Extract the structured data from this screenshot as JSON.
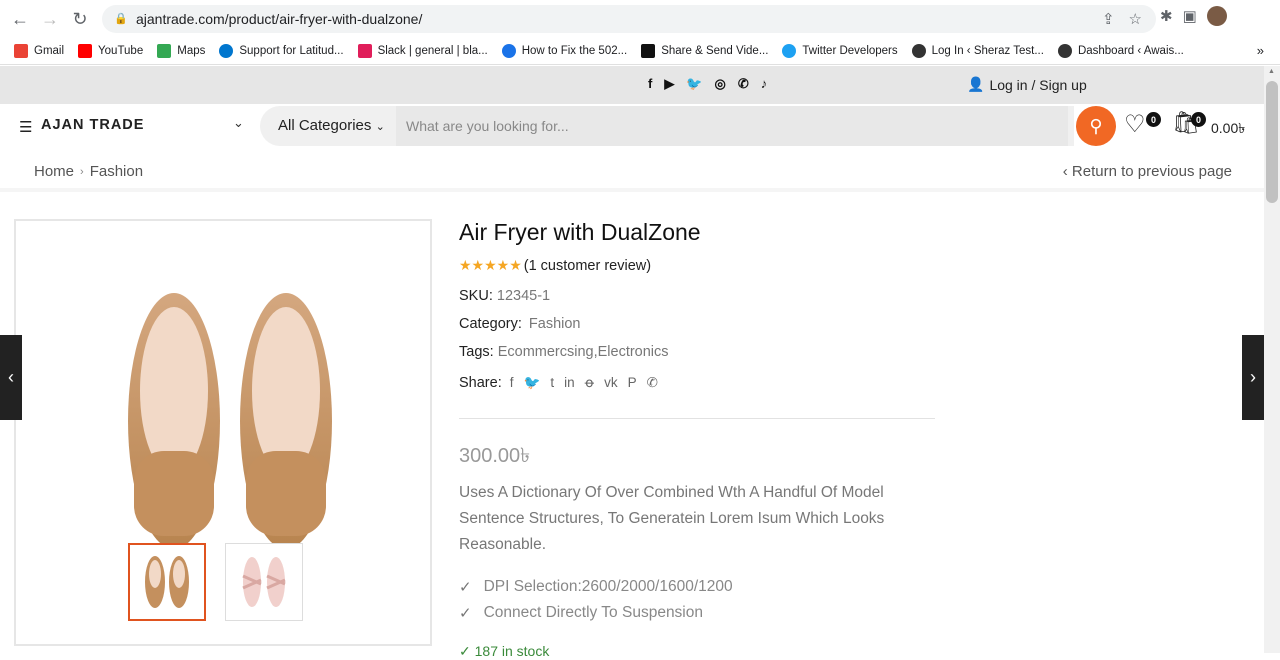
{
  "browser": {
    "url": "ajantrade.com/product/air-fryer-with-dualzone/",
    "bookmarks": [
      {
        "label": "Gmail",
        "icon": "gmail-icon",
        "color": "#ea4335"
      },
      {
        "label": "YouTube",
        "icon": "youtube-icon",
        "color": "#ff0000"
      },
      {
        "label": "Maps",
        "icon": "maps-icon",
        "color": "#34a853"
      },
      {
        "label": "Support for Latitud...",
        "icon": "dell-icon",
        "color": "#0076ce"
      },
      {
        "label": "Slack | general | bla...",
        "icon": "slack-icon",
        "color": "#e01e5a"
      },
      {
        "label": "How to Fix the 502...",
        "icon": "site-icon",
        "color": "#1a73e8"
      },
      {
        "label": "Share & Send Vide...",
        "icon": "vimeo-icon",
        "color": "#111111"
      },
      {
        "label": "Twitter Developers",
        "icon": "twitter-icon",
        "color": "#1da1f2"
      },
      {
        "label": "Log In ‹ Sheraz Test...",
        "icon": "wordpress-icon",
        "color": "#333333"
      },
      {
        "label": "Dashboard ‹ Awais...",
        "icon": "wordpress-icon",
        "color": "#333333"
      }
    ],
    "more": "»"
  },
  "topbar": {
    "social": [
      "f",
      "▶",
      "🐦",
      "◎",
      "✆",
      "♪"
    ],
    "login": "Log in / Sign up"
  },
  "header": {
    "brand": "AJAN TRADE",
    "categories": "All Categories",
    "search_placeholder": "What are you looking for...",
    "wishlist_count": "0",
    "cart_count": "0",
    "cart_total": "0.00৳"
  },
  "breadcrumb": {
    "home": "Home",
    "sep": "›",
    "current": "Fashion",
    "return": "‹ Return to previous page"
  },
  "product": {
    "title": "Air Fryer with DualZone",
    "stars": "★★★★★",
    "review": "(1 customer review)",
    "sku_label": "SKU:",
    "sku": "12345-1",
    "category_label": "Category:",
    "category": "Fashion",
    "tags_label": "Tags:",
    "tags": "Ecommercsing,Electronics",
    "share_label": "Share:",
    "price": "300.00৳",
    "description": "Uses A Dictionary Of Over Combined Wth A Handful Of Model Sentence Structures, To Generatein Lorem Isum Which Looks Reasonable.",
    "features": [
      "DPI Selection:2600/2000/1600/1200",
      "Connect Directly To Suspension"
    ],
    "stock": "✓ 187 in stock"
  },
  "colors": {
    "accent": "#f16824",
    "thumb_active": "#e0531f"
  }
}
